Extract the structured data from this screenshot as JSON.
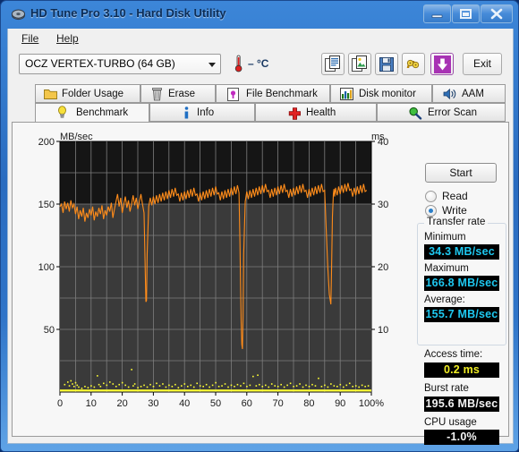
{
  "window": {
    "title": "HD Tune Pro 3.10 - Hard Disk Utility",
    "icon": "hdtune-disk-icon",
    "minimize_label": "Minimize",
    "maximize_label": "Maximize",
    "close_label": "Close"
  },
  "menu": {
    "items": [
      {
        "label": "File",
        "mnemonic": "F"
      },
      {
        "label": "Help",
        "mnemonic": "H"
      }
    ]
  },
  "toolbar": {
    "drive": {
      "selected": "OCZ VERTEX-TURBO (64 GB)",
      "options": [
        "OCZ VERTEX-TURBO (64 GB)"
      ]
    },
    "temperature": "– °C",
    "temperature_icon": "thermometer-icon",
    "buttons": [
      {
        "name": "copy-text-button",
        "icon": "copy-text-icon",
        "label": "Copy text"
      },
      {
        "name": "copy-image-button",
        "icon": "copy-image-icon",
        "label": "Copy image"
      },
      {
        "name": "save-button",
        "icon": "floppy-save-icon",
        "label": "Save"
      },
      {
        "name": "connection-button",
        "icon": "cable-icon",
        "label": "Connection"
      },
      {
        "name": "download-button",
        "icon": "down-arrow-icon",
        "label": "Download"
      }
    ],
    "exit_label": "Exit"
  },
  "tabs": {
    "row1": [
      {
        "label": "Folder Usage",
        "icon": "folder-icon",
        "active": false
      },
      {
        "label": "Erase",
        "icon": "trash-icon",
        "active": false
      },
      {
        "label": "File Benchmark",
        "icon": "file-benchmark-icon",
        "active": false
      },
      {
        "label": "Disk monitor",
        "icon": "bar-chart-icon",
        "active": false
      },
      {
        "label": "AAM",
        "icon": "speaker-icon",
        "active": false
      }
    ],
    "row2": [
      {
        "label": "Benchmark",
        "icon": "lightbulb-icon",
        "active": true
      },
      {
        "label": "Info",
        "icon": "info-icon",
        "active": false
      },
      {
        "label": "Health",
        "icon": "red-cross-icon",
        "active": false
      },
      {
        "label": "Error Scan",
        "icon": "magnifier-icon",
        "active": false
      }
    ]
  },
  "benchmark": {
    "start_label": "Start",
    "mode": {
      "read_label": "Read",
      "write_label": "Write",
      "selected": "Write"
    },
    "transfer_rate": {
      "group_label": "Transfer rate",
      "minimum_label": "Minimum",
      "minimum_value": "34.3 MB/sec",
      "maximum_label": "Maximum",
      "maximum_value": "166.8 MB/sec",
      "average_label": "Average:",
      "average_value": "155.7 MB/sec"
    },
    "access_time_label": "Access time:",
    "access_time_value": "0.2 ms",
    "burst_rate_label": "Burst rate",
    "burst_rate_value": "195.6 MB/sec",
    "cpu_usage_label": "CPU usage",
    "cpu_usage_value": "-1.0%"
  },
  "colors": {
    "transfer_curve": "#ff8c1a",
    "access_dots": "#ffff33",
    "lcd_cyan": "#1ec8f0",
    "lcd_yellow": "#f2ef25",
    "lcd_white": "#f4f4f4",
    "plot_background": "#151515",
    "grid": "#8a8a8a",
    "title_bar": "#3c86d8"
  },
  "chart_data": {
    "type": "line",
    "title": "",
    "xlabel": "",
    "ylabel": "MB/sec",
    "y2label": "ms",
    "xlim": [
      0,
      100
    ],
    "ylim": [
      0,
      200
    ],
    "y2lim": [
      0,
      40
    ],
    "xticks": [
      0,
      10,
      20,
      30,
      40,
      50,
      60,
      70,
      80,
      90,
      100
    ],
    "xticklabels": [
      "0",
      "10",
      "20",
      "30",
      "40",
      "50",
      "60",
      "70",
      "80",
      "90",
      "100%"
    ],
    "yticks": [
      50,
      100,
      150,
      200
    ],
    "yticklabels": [
      "50",
      "100",
      "150",
      "200"
    ],
    "y2ticks": [
      10,
      20,
      30,
      40
    ],
    "y2ticklabels": [
      "10",
      "20",
      "30",
      "40"
    ],
    "grid": true,
    "legend": null,
    "series": [
      {
        "name": "Transfer rate",
        "axis": "left",
        "unit": "MB/sec",
        "color": "#ff8c1a",
        "x": [
          0,
          0.5,
          1,
          1.5,
          2,
          2.5,
          3,
          3.5,
          4,
          4.5,
          5,
          5.5,
          6,
          6.5,
          7,
          7.5,
          8,
          8.5,
          9,
          9.5,
          10,
          10.5,
          11,
          11.5,
          12,
          12.5,
          13,
          13.5,
          14,
          14.5,
          15,
          15.5,
          16,
          16.5,
          17,
          17.5,
          18,
          18.5,
          19,
          19.5,
          20,
          20.5,
          21,
          21.5,
          22,
          22.5,
          23,
          23.5,
          24,
          24.5,
          25,
          25.5,
          26,
          26.5,
          27,
          27.2,
          27.4,
          27.6,
          27.8,
          28,
          28.5,
          29,
          29.5,
          30,
          30.5,
          31,
          31.5,
          32,
          32.5,
          33,
          33.5,
          34,
          34.5,
          35,
          35.5,
          36,
          36.5,
          37,
          37.5,
          38,
          38.5,
          39,
          39.5,
          40,
          40.5,
          41,
          41.5,
          42,
          42.5,
          43,
          43.5,
          44,
          44.5,
          45,
          45.5,
          46,
          46.5,
          47,
          47.5,
          48,
          48.5,
          49,
          49.5,
          50,
          50.5,
          51,
          51.5,
          52,
          52.5,
          53,
          53.5,
          54,
          54.5,
          55,
          55.5,
          56,
          56.5,
          57,
          57.5,
          57.8,
          58,
          58.2,
          58.4,
          58.6,
          58.8,
          59,
          59.5,
          60,
          60.5,
          61,
          61.5,
          62,
          62.5,
          63,
          63.5,
          64,
          64.5,
          65,
          65.5,
          66,
          66.5,
          67,
          67.5,
          68,
          68.5,
          69,
          69.5,
          70,
          70.5,
          71,
          71.5,
          72,
          72.5,
          73,
          73.5,
          74,
          74.5,
          75,
          75.5,
          76,
          76.5,
          77,
          77.5,
          78,
          78.5,
          79,
          79.5,
          80,
          80.5,
          81,
          81.5,
          82,
          82.5,
          83,
          83.5,
          84,
          84.5,
          85,
          85.5,
          86,
          86.5,
          87,
          87.2,
          87.5,
          87.8,
          88,
          88.2,
          88.5,
          89,
          89.5,
          90,
          90.5,
          91,
          91.5,
          92,
          92.5,
          93,
          93.5,
          94,
          94.5,
          95,
          95.5,
          96,
          96.5,
          97,
          97.5,
          98,
          98.5,
          99,
          99.5,
          100
        ],
        "y": [
          148,
          150,
          143,
          152,
          146,
          151,
          144,
          153,
          147,
          150,
          142,
          148,
          138,
          145,
          140,
          147,
          136,
          143,
          139,
          146,
          141,
          148,
          137,
          144,
          140,
          147,
          142,
          149,
          138,
          145,
          141,
          148,
          144,
          151,
          139,
          146,
          152,
          158,
          148,
          155,
          143,
          150,
          156,
          147,
          153,
          144,
          150,
          157,
          149,
          155,
          146,
          152,
          158,
          150,
          143,
          120,
          95,
          72,
          73,
          110,
          148,
          155,
          149,
          156,
          150,
          157,
          151,
          158,
          152,
          159,
          153,
          160,
          154,
          161,
          155,
          162,
          156,
          163,
          157,
          158,
          152,
          159,
          153,
          160,
          154,
          161,
          155,
          162,
          156,
          163,
          157,
          158,
          152,
          159,
          153,
          160,
          154,
          161,
          155,
          162,
          156,
          163,
          157,
          164,
          158,
          159,
          153,
          160,
          154,
          161,
          155,
          162,
          156,
          163,
          157,
          164,
          158,
          165,
          159,
          120,
          85,
          55,
          38,
          34.3,
          60,
          110,
          152,
          160,
          154,
          161,
          155,
          162,
          156,
          163,
          157,
          164,
          158,
          165,
          159,
          166,
          160,
          161,
          155,
          162,
          156,
          163,
          157,
          164,
          158,
          165,
          159,
          166,
          160,
          161,
          155,
          162,
          156,
          163,
          157,
          164,
          158,
          165,
          159,
          166,
          160,
          161,
          155,
          162,
          156,
          163,
          157,
          164,
          158,
          165,
          159,
          166,
          160,
          161,
          130,
          100,
          78,
          70,
          95,
          140,
          158,
          162,
          156,
          163,
          157,
          164,
          158,
          165,
          159,
          166,
          160,
          166.8,
          161,
          162,
          156,
          163,
          157,
          164,
          158,
          165,
          159,
          166,
          160,
          161
        ]
      },
      {
        "name": "Access time",
        "axis": "right",
        "unit": "ms",
        "color": "#ffff33",
        "note": "scattered dots near baseline, most points at ~0.2 ms with occasional spikes up to ~4 ms",
        "baseline_ms": 0.2,
        "x": [
          1.5,
          2.5,
          3,
          3.5,
          4,
          4.5,
          5,
          5.5,
          6,
          7,
          8,
          9,
          10,
          11,
          12,
          12.5,
          13,
          14,
          15,
          16,
          17,
          18,
          19,
          20,
          21,
          22,
          23,
          23.5,
          24,
          25,
          26,
          27,
          28,
          29,
          30,
          31,
          32,
          33,
          34,
          35,
          36,
          37,
          38,
          39,
          40,
          41,
          42,
          43,
          44,
          45,
          46,
          47,
          48,
          49,
          50,
          51,
          52,
          53,
          54,
          55,
          56,
          57,
          58,
          59,
          60,
          61,
          62,
          63,
          63.5,
          64,
          65,
          66,
          67,
          68,
          69,
          70,
          71,
          72,
          73,
          74,
          75,
          76,
          77,
          78,
          79,
          80,
          81,
          82,
          83,
          84,
          85,
          86,
          87,
          88,
          89,
          90,
          91,
          92,
          93,
          94,
          95,
          96,
          97,
          98,
          99
        ],
        "y": [
          1.2,
          1.6,
          1.0,
          1.8,
          1.3,
          0.9,
          1.5,
          1.1,
          0.8,
          0.6,
          0.9,
          0.7,
          1.0,
          0.8,
          2.6,
          1.2,
          0.9,
          1.4,
          1.1,
          1.6,
          1.3,
          0.9,
          1.2,
          1.5,
          1.1,
          0.8,
          3.6,
          1.0,
          1.3,
          0.7,
          0.9,
          1.1,
          0.8,
          1.2,
          0.9,
          1.4,
          1.0,
          1.3,
          0.8,
          1.1,
          0.9,
          1.2,
          0.7,
          1.0,
          1.3,
          0.9,
          1.1,
          0.8,
          1.4,
          1.0,
          0.9,
          1.2,
          0.8,
          1.1,
          1.5,
          0.9,
          1.0,
          1.3,
          0.8,
          1.1,
          0.9,
          1.2,
          1.0,
          1.4,
          0.9,
          1.1,
          2.5,
          1.0,
          2.7,
          1.2,
          0.9,
          1.1,
          0.8,
          1.3,
          1.0,
          0.9,
          1.2,
          0.8,
          1.1,
          1.4,
          0.9,
          1.0,
          1.3,
          0.8,
          1.1,
          0.9,
          1.2,
          1.0,
          2.2,
          0.9,
          1.1,
          0.8,
          1.3,
          1.0,
          0.9,
          1.2,
          0.8,
          1.1,
          1.4,
          0.9,
          1.0,
          0.8,
          1.1,
          0.9,
          1.0,
          0.8,
          1.1
        ]
      }
    ]
  }
}
